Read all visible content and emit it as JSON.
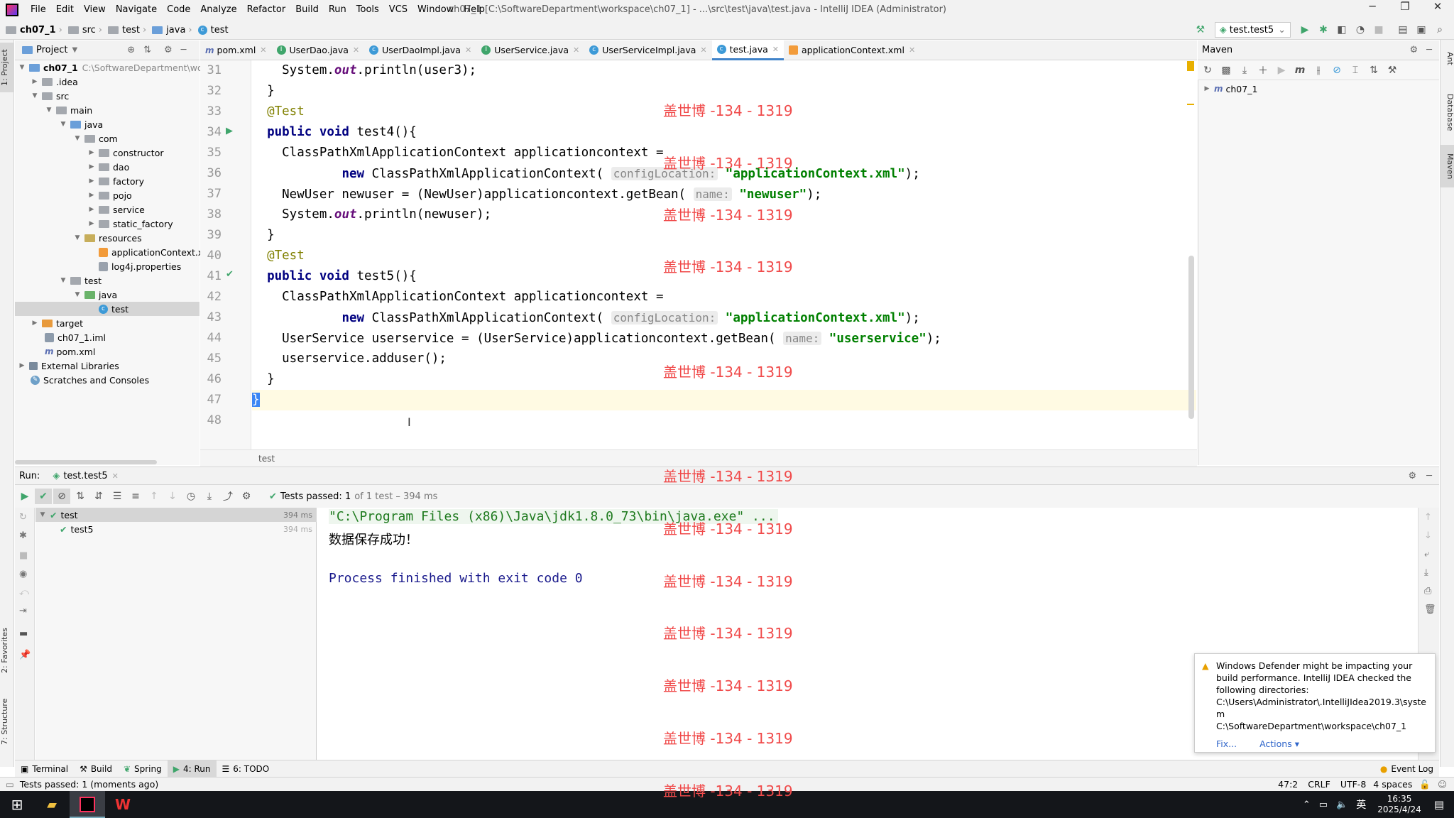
{
  "menu": [
    "File",
    "Edit",
    "View",
    "Navigate",
    "Code",
    "Analyze",
    "Refactor",
    "Build",
    "Run",
    "Tools",
    "VCS",
    "Window",
    "Help"
  ],
  "window_title": "ch07_1 [C:\\SoftwareDepartment\\workspace\\ch07_1] - ...\\src\\test\\java\\test.java - IntelliJ IDEA (Administrator)",
  "breadcrumbs": [
    "ch07_1",
    "src",
    "test",
    "java",
    "test"
  ],
  "run_config": "test.test5",
  "project": {
    "header": "Project",
    "tree": [
      {
        "label": "ch07_1",
        "extra": "C:\\SoftwareDepartment\\work",
        "depth": 0,
        "open": true,
        "kind": "module"
      },
      {
        "label": ".idea",
        "depth": 1,
        "open": false,
        "kind": "folder"
      },
      {
        "label": "src",
        "depth": 1,
        "open": true,
        "kind": "folder"
      },
      {
        "label": "main",
        "depth": 2,
        "open": true,
        "kind": "folder"
      },
      {
        "label": "java",
        "depth": 3,
        "open": true,
        "kind": "folder-blue"
      },
      {
        "label": "com",
        "depth": 4,
        "open": true,
        "kind": "folder"
      },
      {
        "label": "constructor",
        "depth": 5,
        "open": false,
        "kind": "folder"
      },
      {
        "label": "dao",
        "depth": 5,
        "open": false,
        "kind": "folder"
      },
      {
        "label": "factory",
        "depth": 5,
        "open": false,
        "kind": "folder"
      },
      {
        "label": "pojo",
        "depth": 5,
        "open": false,
        "kind": "folder"
      },
      {
        "label": "service",
        "depth": 5,
        "open": false,
        "kind": "folder"
      },
      {
        "label": "static_factory",
        "depth": 5,
        "open": false,
        "kind": "folder"
      },
      {
        "label": "resources",
        "depth": 3,
        "open": true,
        "kind": "folder"
      },
      {
        "label": "applicationContext.xml",
        "depth": 4,
        "kind": "xml"
      },
      {
        "label": "log4j.properties",
        "depth": 4,
        "kind": "props"
      },
      {
        "label": "test",
        "depth": 2,
        "open": true,
        "kind": "folder"
      },
      {
        "label": "java",
        "depth": 3,
        "open": true,
        "kind": "folder-green"
      },
      {
        "label": "test",
        "depth": 4,
        "kind": "class",
        "selected": true
      },
      {
        "label": "target",
        "depth": 1,
        "open": false,
        "kind": "folder-orange"
      },
      {
        "label": "ch07_1.iml",
        "depth": 1,
        "kind": "iml"
      },
      {
        "label": "pom.xml",
        "depth": 1,
        "kind": "pom"
      },
      {
        "label": "External Libraries",
        "depth": 0,
        "open": false,
        "kind": "lib"
      },
      {
        "label": "Scratches and Consoles",
        "depth": 0,
        "kind": "scratch"
      }
    ]
  },
  "tabs": [
    {
      "label": "pom.xml",
      "icon": "m"
    },
    {
      "label": "UserDao.java",
      "icon": "class-green"
    },
    {
      "label": "UserDaoImpl.java",
      "icon": "class"
    },
    {
      "label": "UserService.java",
      "icon": "class-green"
    },
    {
      "label": "UserServiceImpl.java",
      "icon": "class"
    },
    {
      "label": "test.java",
      "icon": "class",
      "active": true
    },
    {
      "label": "applicationContext.xml",
      "icon": "xml"
    }
  ],
  "code": {
    "line_numbers": [
      "31",
      "32",
      "33",
      "34",
      "35",
      "36",
      "37",
      "38",
      "39",
      "40",
      "41",
      "42",
      "43",
      "44",
      "45",
      "46",
      "47",
      "48"
    ],
    "breadcrumb": "test"
  },
  "maven": {
    "header": "Maven",
    "root": "ch07_1"
  },
  "run": {
    "label": "Run:",
    "tab": "test.test5",
    "status": "Tests passed: 1",
    "status_detail": "of 1 test – 394 ms",
    "tree": [
      {
        "label": "test",
        "time": "394 ms"
      },
      {
        "label": "test5",
        "time": "394 ms"
      }
    ],
    "console": [
      "\"C:\\Program Files (x86)\\Java\\jdk1.8.0_73\\bin\\java.exe\" ...",
      "数据保存成功！",
      "",
      "Process finished with exit code 0"
    ]
  },
  "notification": {
    "text": "Windows Defender might be impacting your build performance. IntelliJ IDEA checked the following directories:",
    "dir1": "C:\\Users\\Administrator\\.IntelliJIdea2019.3\\system",
    "dir2": "C:\\SoftwareDepartment\\workspace\\ch07_1",
    "fix": "Fix...",
    "actions": "Actions ▾"
  },
  "bottom_tabs": [
    "Terminal",
    "Build",
    "Spring",
    "4: Run",
    "6: TODO"
  ],
  "event_log": "Event Log",
  "status": {
    "left": "Tests passed: 1 (moments ago)",
    "pos": "47:2",
    "eol": "CRLF",
    "enc": "UTF-8",
    "indent": "4 spaces"
  },
  "taskbar": {
    "ime": "英",
    "time": "16:35",
    "date": "2025/4/24"
  },
  "watermark": "盖世博 -134 - 1319",
  "side_tabs": {
    "project": "1: Project",
    "favorites": "2: Favorites",
    "structure": "7: Structure",
    "ant": "Ant",
    "database": "Database",
    "maven": "Maven"
  }
}
